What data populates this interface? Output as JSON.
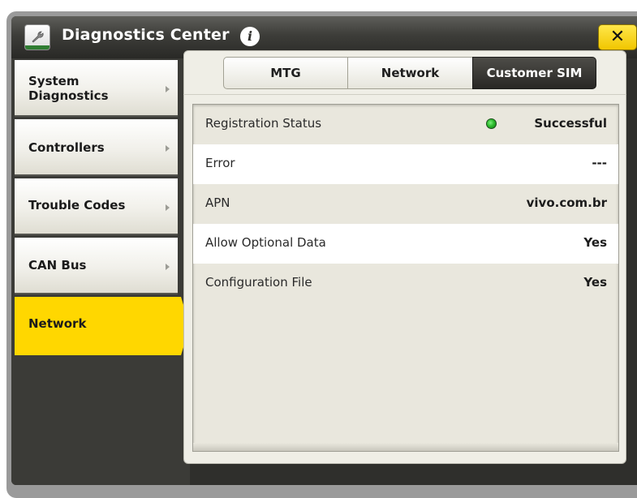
{
  "window": {
    "title": "Diagnostics Center",
    "close_label": "✕",
    "info_label": "i"
  },
  "nav": {
    "items": [
      {
        "label": "System Diagnostics",
        "has_chevron": true
      },
      {
        "label": "Controllers",
        "has_chevron": true
      },
      {
        "label": "Trouble Codes",
        "has_chevron": true
      },
      {
        "label": "CAN Bus",
        "has_chevron": true
      },
      {
        "label": "Network",
        "active": true
      }
    ]
  },
  "tabs": [
    {
      "label": "MTG"
    },
    {
      "label": "Network"
    },
    {
      "label": "Customer SIM",
      "selected": true
    }
  ],
  "table": {
    "rows": [
      {
        "key": "Registration Status",
        "value": "Successful",
        "status_icon": "green-status-light"
      },
      {
        "key": "Error",
        "value": "---"
      },
      {
        "key": "APN",
        "value": "vivo.com.br"
      },
      {
        "key": "Allow Optional Data",
        "value": "Yes"
      },
      {
        "key": "Configuration File",
        "value": "Yes"
      }
    ]
  },
  "colors": {
    "accent_yellow": "#ffd700",
    "title_bar": "#3d3d39",
    "status_green": "#2dbb2d"
  }
}
